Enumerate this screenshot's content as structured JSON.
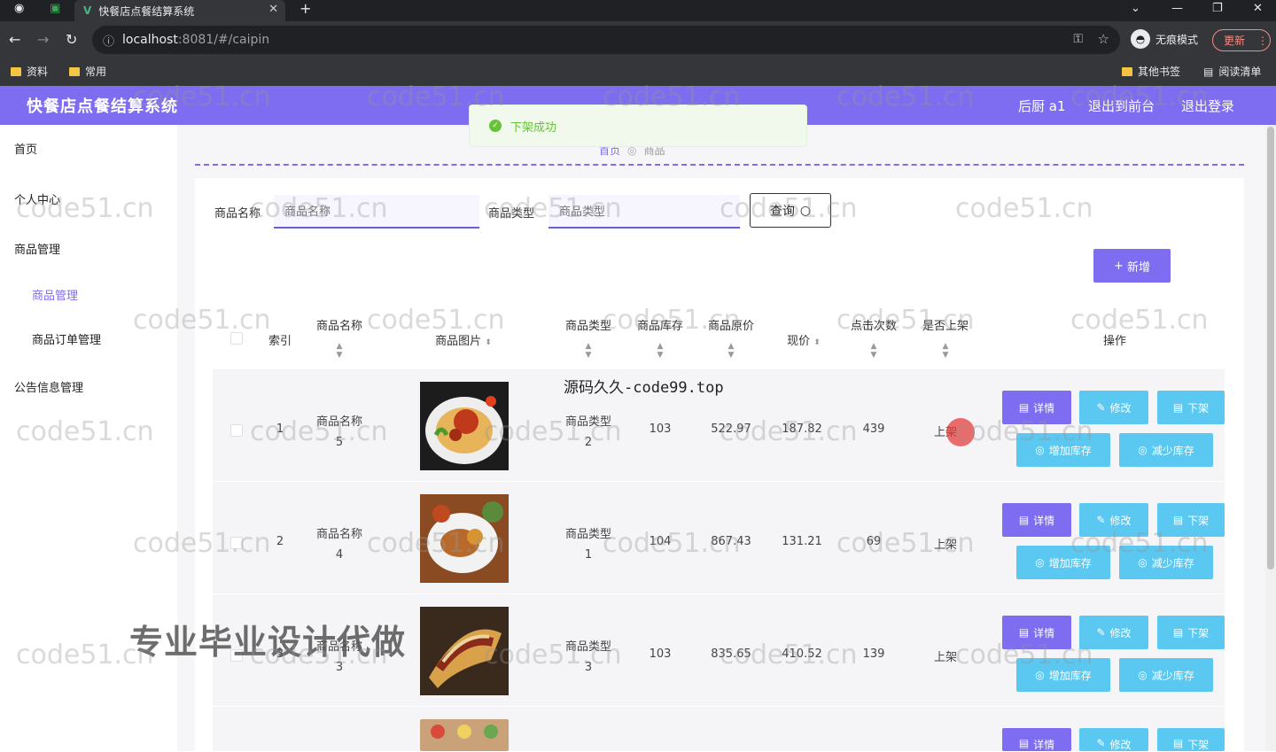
{
  "browser": {
    "tab_title": "快餐店点餐结算系统",
    "tab_logo": "V",
    "url_host": "localhost",
    "url_rest": ":8081/#/caipin",
    "incognito_label": "无痕模式",
    "update_label": "更新",
    "bookmarks": [
      "资料",
      "常用"
    ],
    "bookmarks_right": [
      "其他书签",
      "阅读清单"
    ]
  },
  "header": {
    "title": "快餐店点餐结算系统",
    "user": "后厨 a1",
    "to_front": "退出到前台",
    "logout": "退出登录"
  },
  "sidebar": {
    "items": [
      "首页",
      "个人中心",
      "商品管理",
      "公告信息管理"
    ],
    "sub_items": [
      "商品管理",
      "商品订单管理"
    ]
  },
  "breadcrumb": {
    "home": "首页",
    "current": "商品"
  },
  "message": "下架成功",
  "search": {
    "name_label": "商品名称",
    "name_placeholder": "商品名称",
    "type_label": "商品类型",
    "type_placeholder": "商品类型",
    "query_label": "查询"
  },
  "add_label": "新增",
  "columns": [
    "索引",
    "商品名称",
    "商品图片",
    "商品类型",
    "商品库存",
    "商品原价",
    "现价",
    "点击次数",
    "是否上架",
    "操作"
  ],
  "rows": [
    {
      "index": "1",
      "name": "商品名称\n5",
      "type": "商品类型\n2",
      "stock": "103",
      "orig": "522.97",
      "price": "187.82",
      "clicks": "439",
      "listed": "上架"
    },
    {
      "index": "2",
      "name": "商品名称\n4",
      "type": "商品类型\n1",
      "stock": "104",
      "orig": "867.43",
      "price": "131.21",
      "clicks": "69",
      "listed": "上架"
    },
    {
      "index": "3",
      "name": "商品名称\n3",
      "type": "商品类型\n3",
      "stock": "103",
      "orig": "835.65",
      "price": "410.52",
      "clicks": "139",
      "listed": "上架"
    }
  ],
  "actions": {
    "detail": "详情",
    "edit": "修改",
    "off": "下架",
    "add_stock": "增加库存",
    "reduce_stock": "减少库存"
  },
  "overlay_text": "源码久久-code99.top",
  "banner_text": "专业毕业设计代做",
  "watermark": "code51.cn",
  "colors": {
    "accent": "#7e6df0",
    "sky": "#5ac8f0",
    "success": "#67c23a"
  }
}
